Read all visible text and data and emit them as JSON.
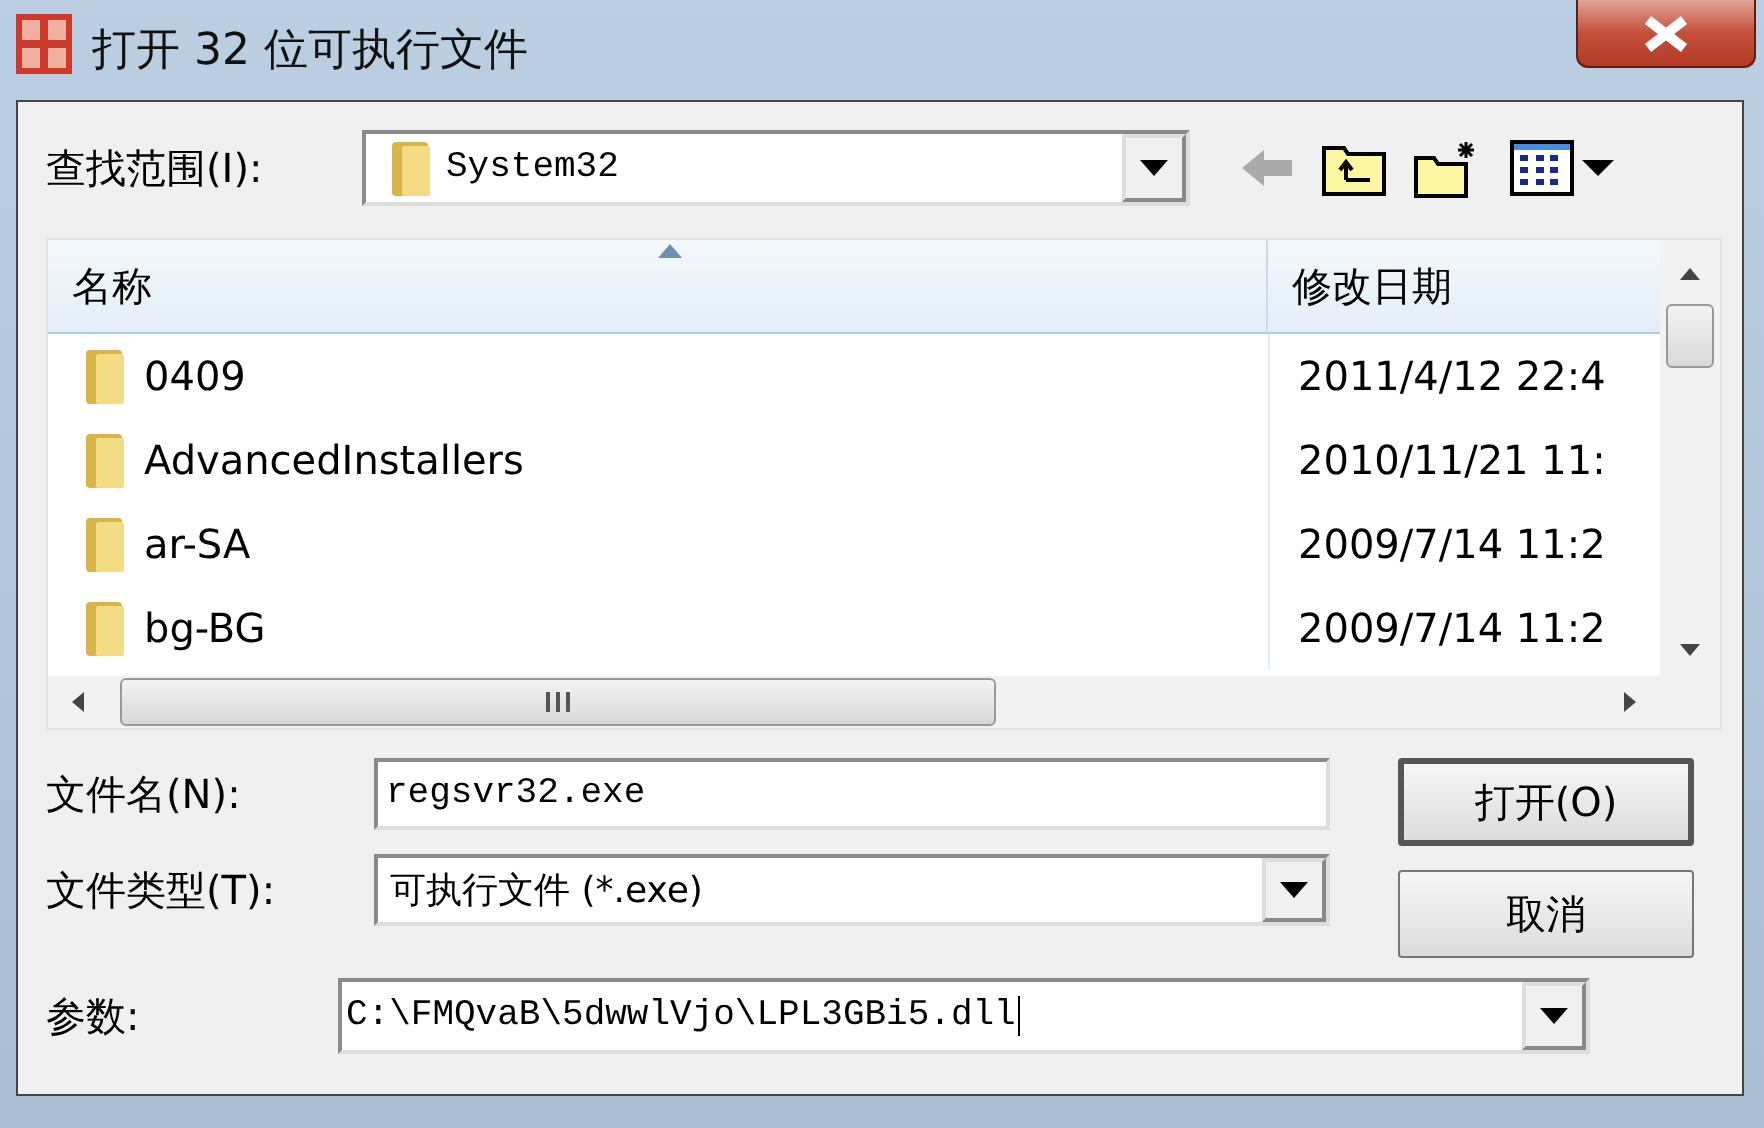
{
  "window": {
    "title": "打开 32 位可执行文件"
  },
  "look_in": {
    "label": "查找范围(I):",
    "value": "System32"
  },
  "file_list": {
    "columns": [
      {
        "label": "名称",
        "sorted": true
      },
      {
        "label": "修改日期",
        "sorted": false
      }
    ],
    "rows": [
      {
        "name": "0409",
        "date": "2011/4/12 22:4"
      },
      {
        "name": "AdvancedInstallers",
        "date": "2010/11/21 11:"
      },
      {
        "name": "ar-SA",
        "date": "2009/7/14 11:2"
      },
      {
        "name": "bg-BG",
        "date": "2009/7/14 11:2"
      }
    ]
  },
  "file_name": {
    "label": "文件名(N):",
    "value": "regsvr32.exe"
  },
  "file_type": {
    "label": "文件类型(T):",
    "value": "可执行文件 (*.exe)"
  },
  "parameters": {
    "label": "参数:",
    "value": "C:\\FMQvaB\\5dwwlVjo\\LPL3GBi5.dll"
  },
  "buttons": [
    {
      "label": "打开(O)",
      "default": true
    },
    {
      "label": "取消",
      "default": false
    }
  ]
}
